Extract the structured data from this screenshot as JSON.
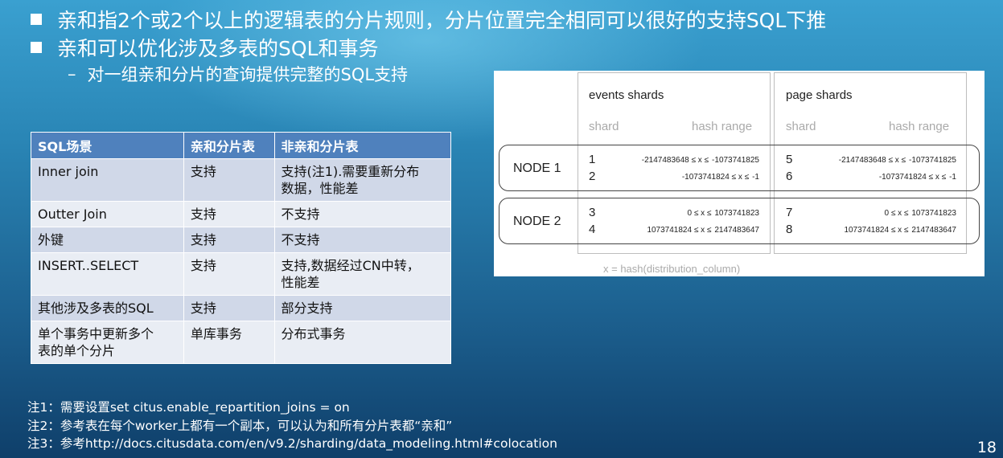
{
  "bullets": [
    "亲和指2个或2个以上的逻辑表的分片规则，分片位置完全相同可以很好的支持SQL下推",
    "亲和可以优化涉及多表的SQL和事务"
  ],
  "sub_bullet": {
    "dash": "–",
    "text": "对一组亲和分片的查询提供完整的SQL支持"
  },
  "table": {
    "headers": [
      "SQL场景",
      "亲和分片表",
      "非亲和分片表"
    ],
    "rows": [
      [
        "Inner join",
        "支持",
        "支持(注1).需要重新分布\n数据，性能差"
      ],
      [
        "Outter Join",
        "支持",
        "不支持"
      ],
      [
        "外键",
        "支持",
        "不支持"
      ],
      [
        "INSERT..SELECT",
        "支持",
        "支持,数据经过CN中转，\n性能差"
      ],
      [
        "其他涉及多表的SQL",
        "支持",
        "部分支持"
      ],
      [
        "单个事务中更新多个\n表的单个分片",
        "单库事务",
        "分布式事务"
      ]
    ]
  },
  "notes": [
    "注1：需要设置set citus.enable_repartition_joins = on",
    "注2：参考表在每个worker上都有一个副本，可以认为和所有分片表都“亲和”",
    "注3：参考http://docs.citusdata.com/en/v9.2/sharding/data_modeling.html#colocation"
  ],
  "diagram": {
    "columns": [
      {
        "title": "events shards",
        "shard_label": "shard",
        "range_label": "hash range"
      },
      {
        "title": "page shards",
        "shard_label": "shard",
        "range_label": "hash range"
      }
    ],
    "nodes": [
      {
        "label": "NODE 1",
        "events": [
          {
            "shard": "1",
            "lo": "-2147483648 ≤ x ≤",
            "hi": "-1073741825"
          },
          {
            "shard": "2",
            "lo": "-1073741824 ≤ x ≤",
            "hi": "-1"
          }
        ],
        "pages": [
          {
            "shard": "5",
            "lo": "-2147483648 ≤ x ≤",
            "hi": "-1073741825"
          },
          {
            "shard": "6",
            "lo": "-1073741824 ≤ x ≤",
            "hi": "-1"
          }
        ]
      },
      {
        "label": "NODE 2",
        "events": [
          {
            "shard": "3",
            "lo": "0 ≤ x ≤",
            "hi": "1073741823"
          },
          {
            "shard": "4",
            "lo": "1073741824 ≤ x ≤",
            "hi": "2147483647"
          }
        ],
        "pages": [
          {
            "shard": "7",
            "lo": "0 ≤ x ≤",
            "hi": "1073741823"
          },
          {
            "shard": "8",
            "lo": "1073741824 ≤ x ≤",
            "hi": "2147483647"
          }
        ]
      }
    ],
    "formula": "x = hash(distribution_column)"
  },
  "page_number": "18"
}
